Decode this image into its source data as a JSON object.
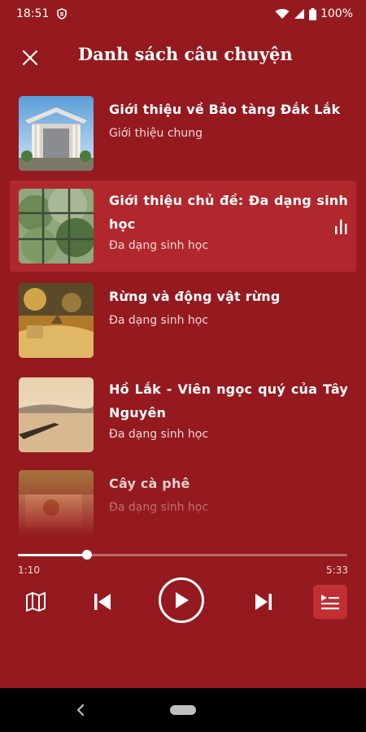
{
  "status": {
    "time": "18:51",
    "battery": "100%"
  },
  "header": {
    "title": "Danh sách câu chuyện"
  },
  "stories": [
    {
      "title": "Giới thiệu về Bảo tàng Đắk Lắk",
      "subtitle": "Giới thiệu chung",
      "playing": false
    },
    {
      "title": "Giới thiệu chủ đề: Đa dạng sinh học",
      "subtitle": "Đa dạng sinh học",
      "playing": true
    },
    {
      "title": "Rừng và động vật rừng",
      "subtitle": "Đa dạng sinh học",
      "playing": false
    },
    {
      "title": "Hồ Lắk - Viên ngọc quý của Tây Nguyên",
      "subtitle": "Đa dạng sinh học",
      "playing": false
    },
    {
      "title": "Cây cà phê",
      "subtitle": "Đa dạng sinh học",
      "playing": false
    }
  ],
  "player": {
    "elapsed": "1:10",
    "duration": "5:33",
    "progress": 0.21
  },
  "icons": {
    "close": "close-icon",
    "map": "map-icon",
    "previous": "skip-previous-icon",
    "play": "play-icon",
    "next": "skip-next-icon",
    "queue": "playlist-icon",
    "equalizer": "equalizer-icon"
  },
  "colors": {
    "background": "#941a1f",
    "active_row": "#b0282d",
    "accent": "#c12e33"
  }
}
